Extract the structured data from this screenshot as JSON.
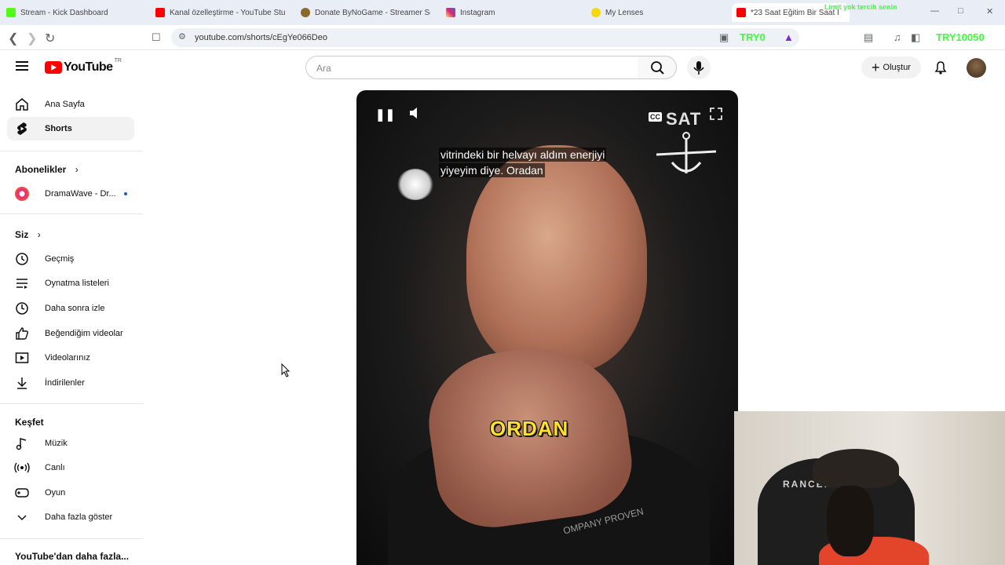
{
  "browser": {
    "tabs": [
      {
        "title": "Stream - Kick Dashboard",
        "icon": "kick-icon",
        "color": "#53fc18"
      },
      {
        "title": "Kanal özelleştirme - YouTube Studi",
        "icon": "youtube-icon",
        "color": "#ff0000"
      },
      {
        "title": "Donate ByNoGame - Streamer Sett",
        "icon": "bynogame-icon",
        "color": "#8a6a2a"
      },
      {
        "title": "Instagram",
        "icon": "instagram-icon",
        "color": "#d62976"
      },
      {
        "title": "My Lenses",
        "icon": "lens-icon",
        "color": "#f5d90a"
      },
      {
        "title": "*23 Saat Eğitim Bir Saat İ",
        "icon": "youtube-icon",
        "color": "#ff0000"
      }
    ],
    "url": "youtube.com/shorts/cEgYe066Deo",
    "overlay_line1": "Limit yok tercih senin",
    "overlay_left": "TRY0",
    "overlay_right": "TRY10050"
  },
  "header": {
    "logo_text": "YouTube",
    "country_code": "TR",
    "search_placeholder": "Ara",
    "create_label": "Oluştur"
  },
  "sidebar": {
    "main": [
      {
        "label": "Ana Sayfa",
        "icon": "home-icon"
      },
      {
        "label": "Shorts",
        "icon": "shorts-icon",
        "active": true
      }
    ],
    "subscriptions_title": "Abonelikler",
    "subscriptions": [
      {
        "label": "DramaWave - Dr...",
        "icon": "dramawave-avatar"
      }
    ],
    "you_title": "Siz",
    "you": [
      {
        "label": "Geçmiş",
        "icon": "history-icon"
      },
      {
        "label": "Oynatma listeleri",
        "icon": "playlist-icon"
      },
      {
        "label": "Daha sonra izle",
        "icon": "clock-icon"
      },
      {
        "label": "Beğendiğim videolar",
        "icon": "thumbs-up-icon"
      },
      {
        "label": "Videolarınız",
        "icon": "your-videos-icon"
      },
      {
        "label": "İndirilenler",
        "icon": "download-icon"
      }
    ],
    "explore_title": "Keşfet",
    "explore": [
      {
        "label": "Müzik",
        "icon": "music-icon"
      },
      {
        "label": "Canlı",
        "icon": "live-icon"
      },
      {
        "label": "Oyun",
        "icon": "gaming-icon"
      },
      {
        "label": "Daha fazla göster",
        "icon": "chevron-down-icon"
      }
    ],
    "more_title": "YouTube'dan daha fazla..."
  },
  "video": {
    "subtitle_line1": "vitrindeki bir helvayı aldım enerjiyi",
    "subtitle_line2": "yiyeyim diye. Oradan",
    "caption_word": "ORDAN",
    "brand": "SAT",
    "shirt_text": "OMPANY PROVEN",
    "cc_label": "CC"
  },
  "webcam": {
    "chair_brand": "RANCER"
  }
}
